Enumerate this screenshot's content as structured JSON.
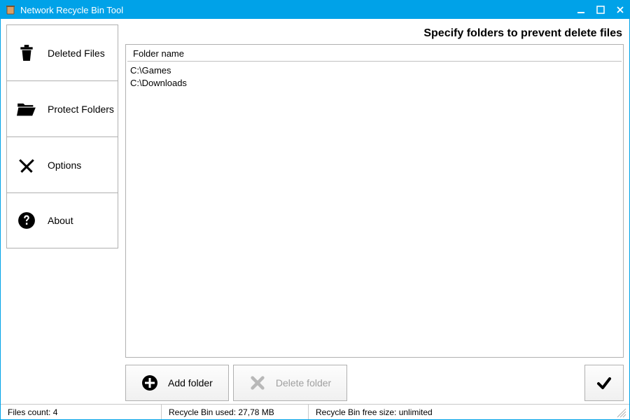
{
  "window": {
    "title": "Network Recycle Bin Tool"
  },
  "sidebar": {
    "items": [
      {
        "label": "Deleted Files"
      },
      {
        "label": "Protect Folders"
      },
      {
        "label": "Options"
      },
      {
        "label": "About"
      }
    ]
  },
  "main": {
    "heading": "Specify folders to prevent delete files",
    "column_header": "Folder name",
    "rows": [
      "C:\\Games",
      "C:\\Downloads"
    ]
  },
  "actions": {
    "add_label": "Add folder",
    "delete_label": "Delete folder"
  },
  "status": {
    "files_count": "Files count: 4",
    "used": "Recycle Bin used: 27,78 MB",
    "free": "Recycle Bin free size: unlimited"
  }
}
